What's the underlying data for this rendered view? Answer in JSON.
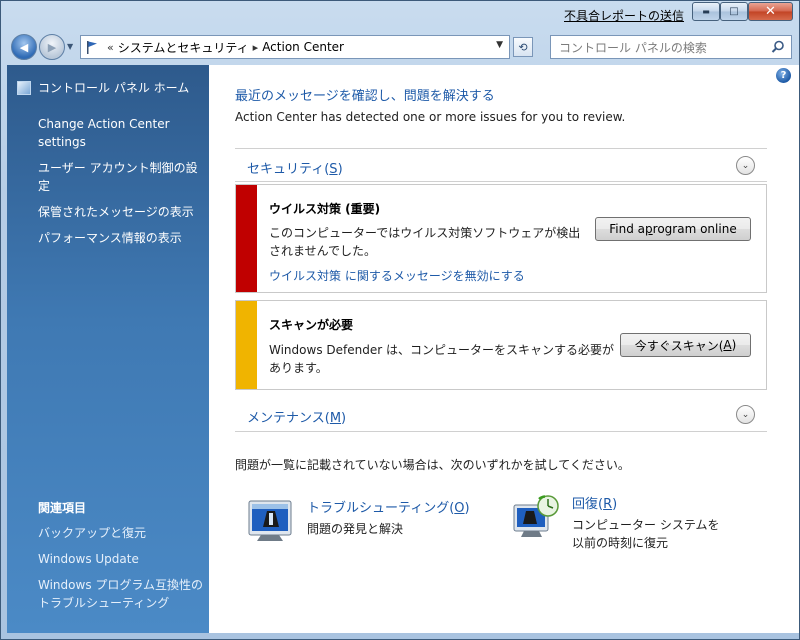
{
  "titlebar": {
    "report_link": "不具合レポートの送信",
    "minimize_glyph": "▬",
    "maximize_glyph": "□",
    "close_glyph": "✕"
  },
  "nav": {
    "back_glyph": "◀",
    "forward_glyph": "▶",
    "breadcrumb_prefix": "«",
    "breadcrumbs": [
      "システムとセキュリティ",
      "Action Center"
    ],
    "crumb_separator": "▸",
    "search_placeholder": "コントロール パネルの検索"
  },
  "sidebar": {
    "home": "コントロール パネル ホーム",
    "tasks": [
      "Change Action Center settings",
      "ユーザー アカウント制御の設定",
      "保管されたメッセージの表示",
      "パフォーマンス情報の表示"
    ],
    "related_heading": "関連項目",
    "related": [
      "バックアップと復元",
      "Windows Update",
      "Windows プログラム互換性のトラブルシューティング"
    ]
  },
  "main": {
    "help": "?",
    "title": "最近のメッセージを確認し、問題を解決する",
    "subtitle": "Action Center has detected one or more issues for you to review.",
    "security": {
      "label_pre": "セキュリティ(",
      "label_key": "S",
      "label_post": ")"
    },
    "alerts": [
      {
        "title": "ウイルス対策 (重要)",
        "text_line1": "このコンピューターではウイルス対策ソフトウェアが検出",
        "text_line2": "されませんでした。",
        "link": "ウイルス対策 に関するメッセージを無効にする",
        "button_pre": "Find a ",
        "button_key": "p",
        "button_post": "rogram online",
        "color": "#c00000"
      },
      {
        "title": "スキャンが必要",
        "text_line1": "Windows Defender は、コンピューターをスキャンする必要が",
        "text_line2": "あります。",
        "button_pre": "今すぐスキャン(",
        "button_key": "A",
        "button_post": ")",
        "color": "#f0b400"
      }
    ],
    "maintenance": {
      "label_pre": "メンテナンス(",
      "label_key": "M",
      "label_post": ")"
    },
    "try_text": "問題が一覧に記載されていない場合は、次のいずれかを試してください。",
    "tools": [
      {
        "link_pre": "トラブルシューティング(",
        "link_key": "O",
        "link_post": ")",
        "desc": [
          "問題の発見と解決"
        ],
        "icon": "troubleshooting-icon"
      },
      {
        "link_pre": "回復(",
        "link_key": "R",
        "link_post": ")",
        "desc": [
          "コンピューター システムを",
          "以前の時刻に復元"
        ],
        "icon": "recovery-icon"
      }
    ]
  }
}
